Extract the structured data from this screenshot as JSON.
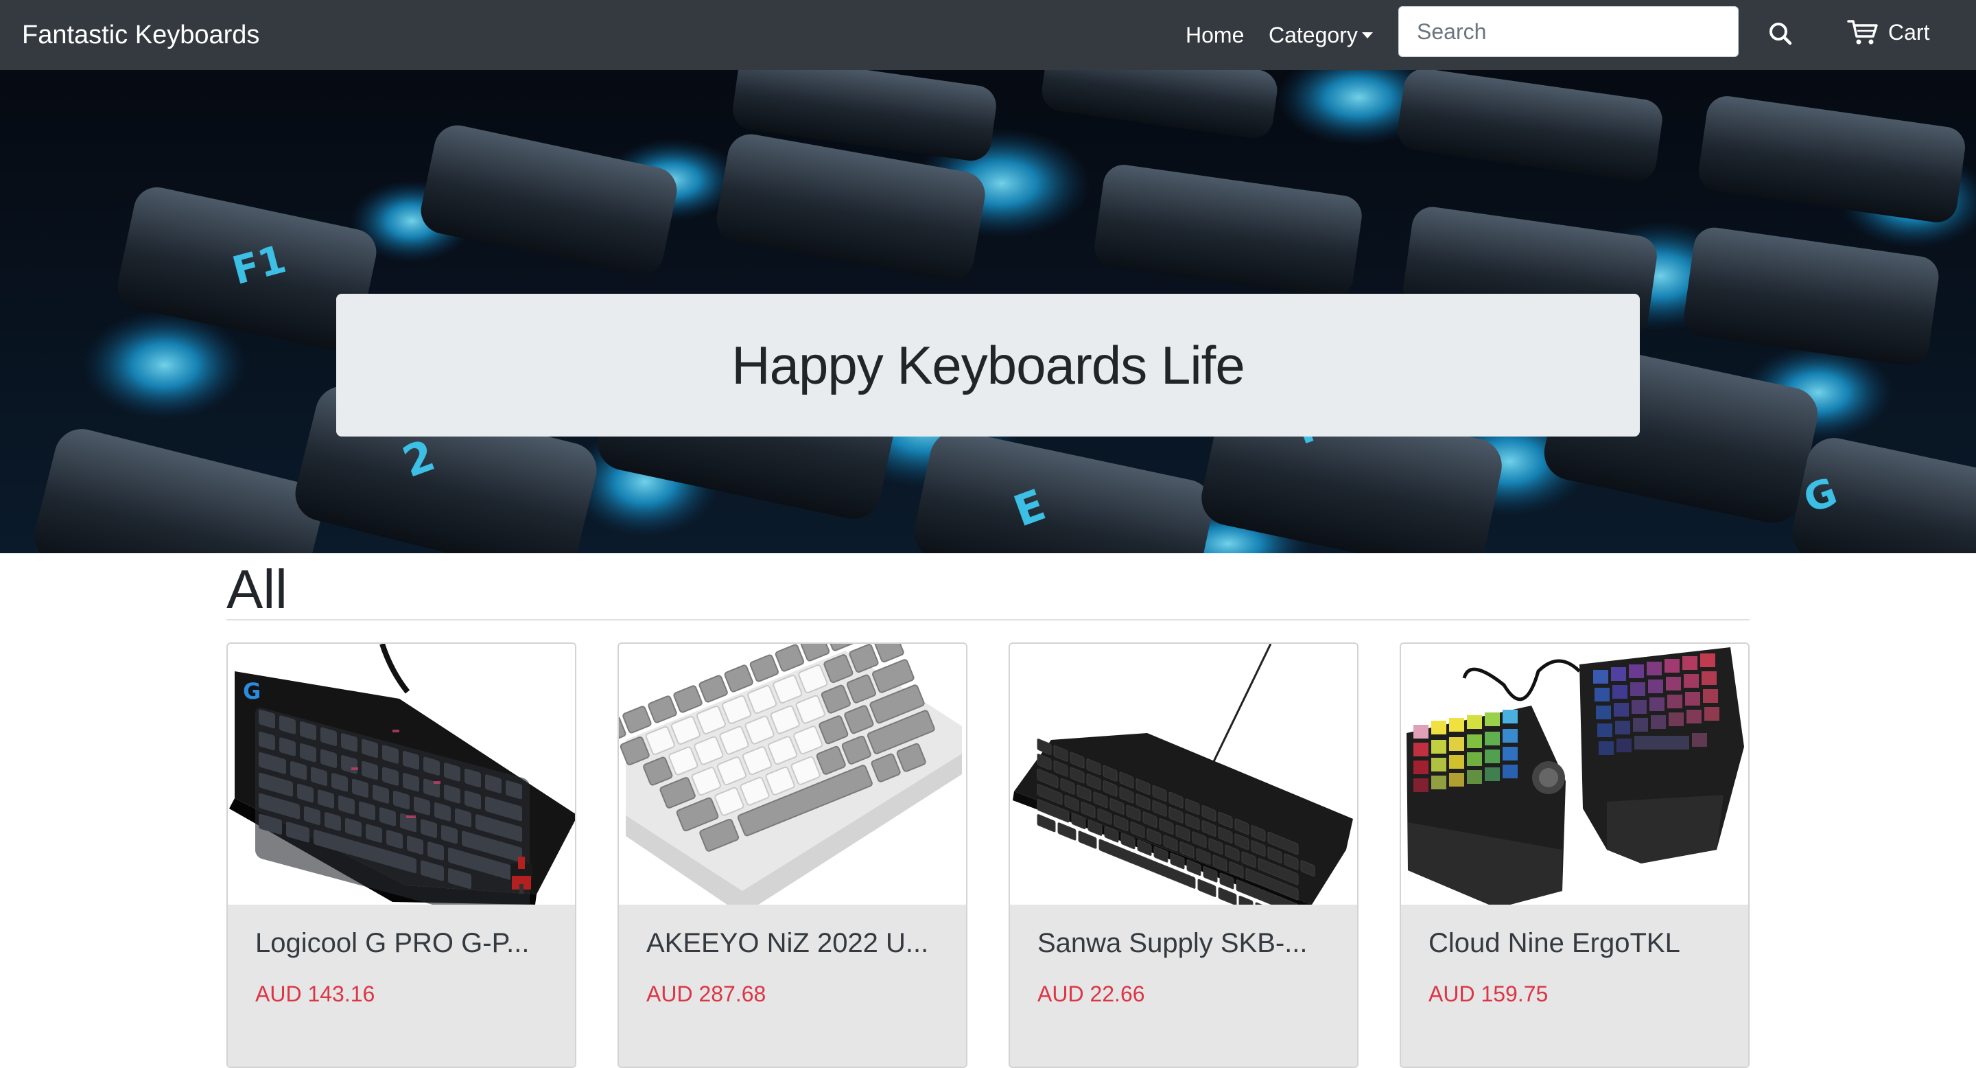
{
  "navbar": {
    "brand": "Fantastic Keyboards",
    "home_label": "Home",
    "category_label": "Category",
    "search_placeholder": "Search",
    "cart_label": "Cart"
  },
  "hero": {
    "heading": "Happy Keyboards Life"
  },
  "section": {
    "title": "All"
  },
  "products": [
    {
      "title": "Logicool G PRO G-P...",
      "price": "AUD 143.16"
    },
    {
      "title": "AKEEYO NiZ 2022 U...",
      "price": "AUD 287.68"
    },
    {
      "title": "Sanwa Supply SKB-...",
      "price": "AUD 22.66"
    },
    {
      "title": "Cloud Nine ErgoTKL",
      "price": "AUD 159.75"
    }
  ],
  "colors": {
    "navbar_bg": "#343a40",
    "price": "#dc3545",
    "jumbotron_bg": "#e9ecef",
    "card_body_bg": "#e6e6e6"
  }
}
